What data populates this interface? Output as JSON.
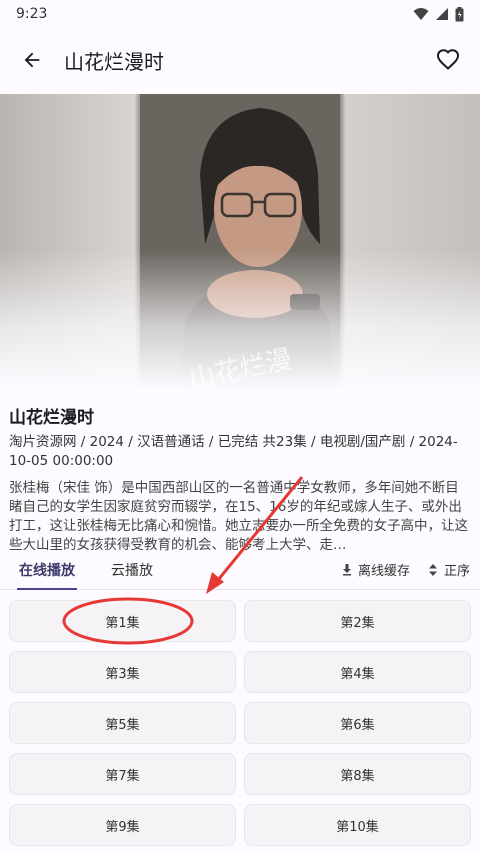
{
  "status": {
    "time": "9:23"
  },
  "app_bar": {
    "title": "山花烂漫时"
  },
  "show": {
    "title": "山花烂漫时",
    "meta": "淘片资源网 / 2024 / 汉语普通话 / 已完结 共23集 / 电视剧/国产剧 / 2024-10-05 00:00:00",
    "description": "张桂梅（宋佳 饰）是中国西部山区的一名普通中学女教师，多年间她不断目睹自己的女学生因家庭贫穷而辍学，在15、16岁的年纪或嫁人生子、或外出打工，这让张桂梅无比痛心和惋惜。她立志要办一所全免费的女子高中，让这些大山里的女孩获得受教育的机会、能够考上大学、走…",
    "poster_text": "山花烂漫"
  },
  "tabs": [
    "在线播放",
    "云播放"
  ],
  "actions": {
    "cache": "离线缓存",
    "order": "正序"
  },
  "episodes": [
    "第1集",
    "第2集",
    "第3集",
    "第4集",
    "第5集",
    "第6集",
    "第7集",
    "第8集",
    "第9集",
    "第10集"
  ],
  "colors": {
    "accent": "#4a4593",
    "annotation": "#e53935",
    "background": "#fdfbff"
  }
}
